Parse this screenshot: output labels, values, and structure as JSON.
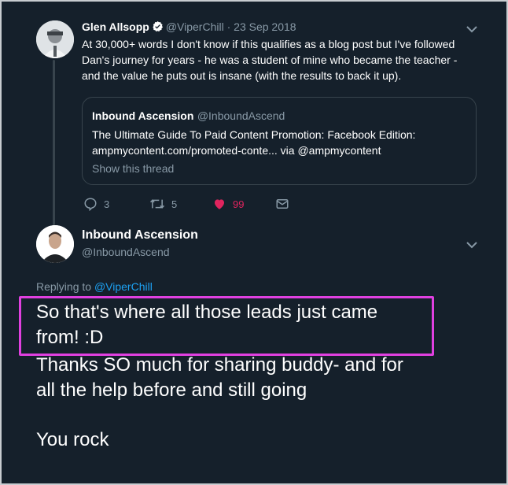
{
  "tweet1": {
    "name": "Glen Allsopp",
    "handle": "@ViperChill",
    "separator": "·",
    "date": "23 Sep 2018",
    "text": "At 30,000+ words I don't know if this qualifies as a blog post but I've followed Dan's journey for years - he was a student of mine who became the teacher - and the value he puts out is insane (with the results to back it up).",
    "quote": {
      "name": "Inbound Ascension",
      "handle": "@InboundAscend",
      "text_line1": "The Ultimate Guide To Paid Content Promotion: Facebook Edition:",
      "text_line2": "ampmycontent.com/promoted-conte... via @ampmycontent",
      "show_thread": "Show this thread"
    },
    "actions": {
      "replies": "3",
      "retweets": "5",
      "likes": "99"
    },
    "colors": {
      "like": "#e0245e",
      "verified": "#ffffff"
    }
  },
  "tweet2": {
    "name": "Inbound Ascension",
    "handle": "@InboundAscend",
    "replying_prefix": "Replying to",
    "replying_to": "@ViperChill",
    "text_line1": "So that's where all those leads just came",
    "text_line2": "from! :D",
    "text_line3": "Thanks SO much for sharing buddy- and for",
    "text_line4": "all the help before and still going",
    "text_line5": "You rock"
  },
  "colors": {
    "background": "#15202b",
    "text_secondary": "#8899a6",
    "link": "#1da1f2",
    "highlight": "#e040e0"
  }
}
